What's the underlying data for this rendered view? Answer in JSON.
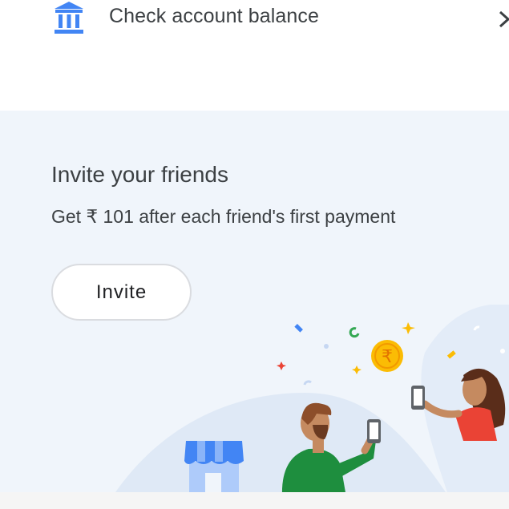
{
  "header": {
    "title": "Check account balance",
    "icon": "bank-icon",
    "trailing_icon": "chevron-right-icon"
  },
  "promo": {
    "title": "Invite your friends",
    "subtitle": "Get ₹ 101 after each friend's first payment",
    "button_label": "Invite",
    "coin_symbol": "₹"
  },
  "colors": {
    "accent_blue": "#4285f4",
    "coin_yellow": "#fbbc04",
    "promo_background": "#f0f5fb",
    "shirt_green": "#1e8e3e",
    "shirt_red": "#ea4335"
  }
}
